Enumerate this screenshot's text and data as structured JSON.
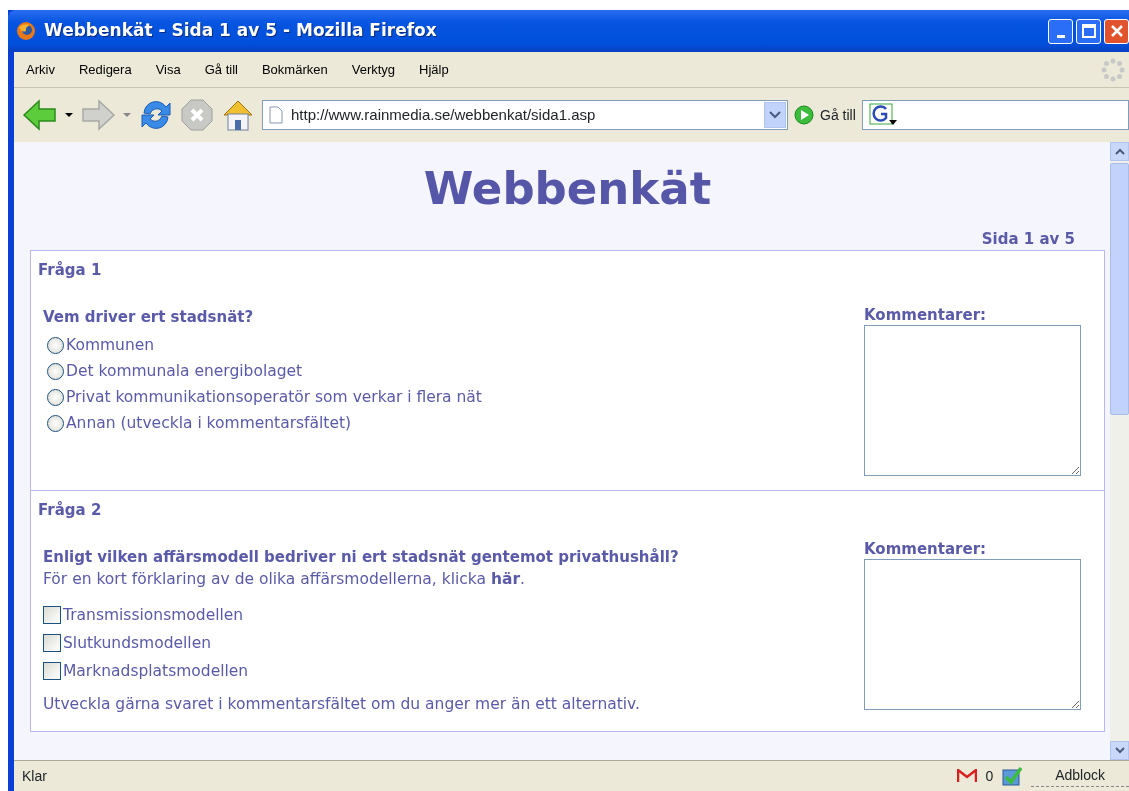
{
  "window": {
    "title": "Webbenkät - Sida 1 av 5 - Mozilla Firefox"
  },
  "menu": [
    "Arkiv",
    "Redigera",
    "Visa",
    "Gå till",
    "Bokmärken",
    "Verktyg",
    "Hjälp"
  ],
  "toolbar": {
    "forward_disabled": true,
    "stop_disabled": true,
    "address": "http://www.rainmedia.se/webbenkat/sida1.asp",
    "go_label": "Gå till"
  },
  "page": {
    "heading": "Webbenkät",
    "page_indicator": "Sida 1 av 5",
    "questions": [
      {
        "title": "Fråga 1",
        "question": "Vem driver ert stadsnät?",
        "kind": "radio",
        "options": [
          {
            "label": "Kommunen",
            "selected": false
          },
          {
            "label": "Det kommunala energibolaget",
            "selected": false
          },
          {
            "label": "Privat kommunikationsoperatör som verkar i flera nät",
            "selected": false
          },
          {
            "label": "Annan (utveckla i kommentarsfältet)",
            "selected": false
          }
        ],
        "comments_label": "Kommentarer:"
      },
      {
        "title": "Fråga 2",
        "question": "Enligt vilken affärsmodell bedriver ni ert stadsnät gentemot privathushåll?",
        "intro": "För en kort förklaring av de olika affärsmodellerna, klicka **här**.",
        "kind": "checkbox",
        "options": [
          {
            "label": "Transmissionsmodellen",
            "checked": false
          },
          {
            "label": "Slutkundsmodellen",
            "checked": false
          },
          {
            "label": "Marknadsplatsmodellen",
            "checked": false
          }
        ],
        "note": "Utveckla gärna svaret i kommentarsfältet om du anger mer än ett alternativ.",
        "comments_label": "Kommentarer:"
      }
    ]
  },
  "status_bar": {
    "text": "Klar",
    "mail_count": "0",
    "adblock": "Adblock"
  }
}
